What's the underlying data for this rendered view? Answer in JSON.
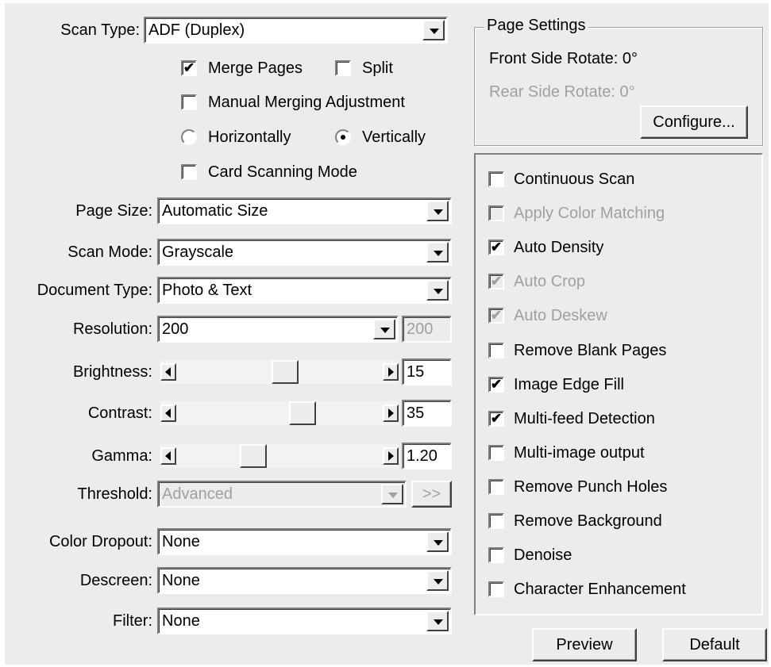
{
  "scan_type": {
    "label": "Scan Type:",
    "value": "ADF (Duplex)"
  },
  "merge_pages": {
    "label": "Merge Pages",
    "checked": true
  },
  "split": {
    "label": "Split",
    "checked": false
  },
  "manual_merging": {
    "label": "Manual Merging Adjustment",
    "checked": false
  },
  "orientation": {
    "horizontally": {
      "label": "Horizontally",
      "selected": false
    },
    "vertically": {
      "label": "Vertically",
      "selected": true
    }
  },
  "card_scanning": {
    "label": "Card Scanning Mode",
    "checked": false
  },
  "page_size": {
    "label": "Page Size:",
    "value": "Automatic Size"
  },
  "scan_mode": {
    "label": "Scan Mode:",
    "value": "Grayscale"
  },
  "document_type": {
    "label": "Document Type:",
    "value": "Photo & Text"
  },
  "resolution": {
    "label": "Resolution:",
    "value": "200",
    "custom_value": "200"
  },
  "brightness": {
    "label": "Brightness:",
    "value": "15",
    "level": 0.53
  },
  "contrast": {
    "label": "Contrast:",
    "value": "35",
    "level": 0.63
  },
  "gamma": {
    "label": "Gamma:",
    "value": "1.20",
    "level": 0.35
  },
  "threshold": {
    "label": "Threshold:",
    "value": "Advanced",
    "button_label": ">>"
  },
  "color_dropout": {
    "label": "Color Dropout:",
    "value": "None"
  },
  "descreen": {
    "label": "Descreen:",
    "value": "None"
  },
  "filter": {
    "label": "Filter:",
    "value": "None"
  },
  "page_settings": {
    "title": "Page Settings",
    "front_rotate": "Front Side Rotate: 0°",
    "rear_rotate": "Rear Side Rotate: 0°",
    "configure_label": "Configure..."
  },
  "options": [
    {
      "label": "Continuous Scan",
      "checked": false,
      "enabled": true
    },
    {
      "label": "Apply Color Matching",
      "checked": false,
      "enabled": false
    },
    {
      "label": "Auto Density",
      "checked": true,
      "enabled": true
    },
    {
      "label": "Auto Crop",
      "checked": true,
      "enabled": false
    },
    {
      "label": "Auto Deskew",
      "checked": true,
      "enabled": false
    },
    {
      "label": "Remove Blank Pages",
      "checked": false,
      "enabled": true
    },
    {
      "label": "Image Edge Fill",
      "checked": true,
      "enabled": true
    },
    {
      "label": "Multi-feed Detection",
      "checked": true,
      "enabled": true
    },
    {
      "label": "Multi-image output",
      "checked": false,
      "enabled": true
    },
    {
      "label": "Remove Punch Holes",
      "checked": false,
      "enabled": true
    },
    {
      "label": "Remove Background",
      "checked": false,
      "enabled": true
    },
    {
      "label": "Denoise",
      "checked": false,
      "enabled": true
    },
    {
      "label": "Character Enhancement",
      "checked": false,
      "enabled": true
    }
  ],
  "preview_label": "Preview",
  "default_label": "Default",
  "check_glyph": "✔"
}
